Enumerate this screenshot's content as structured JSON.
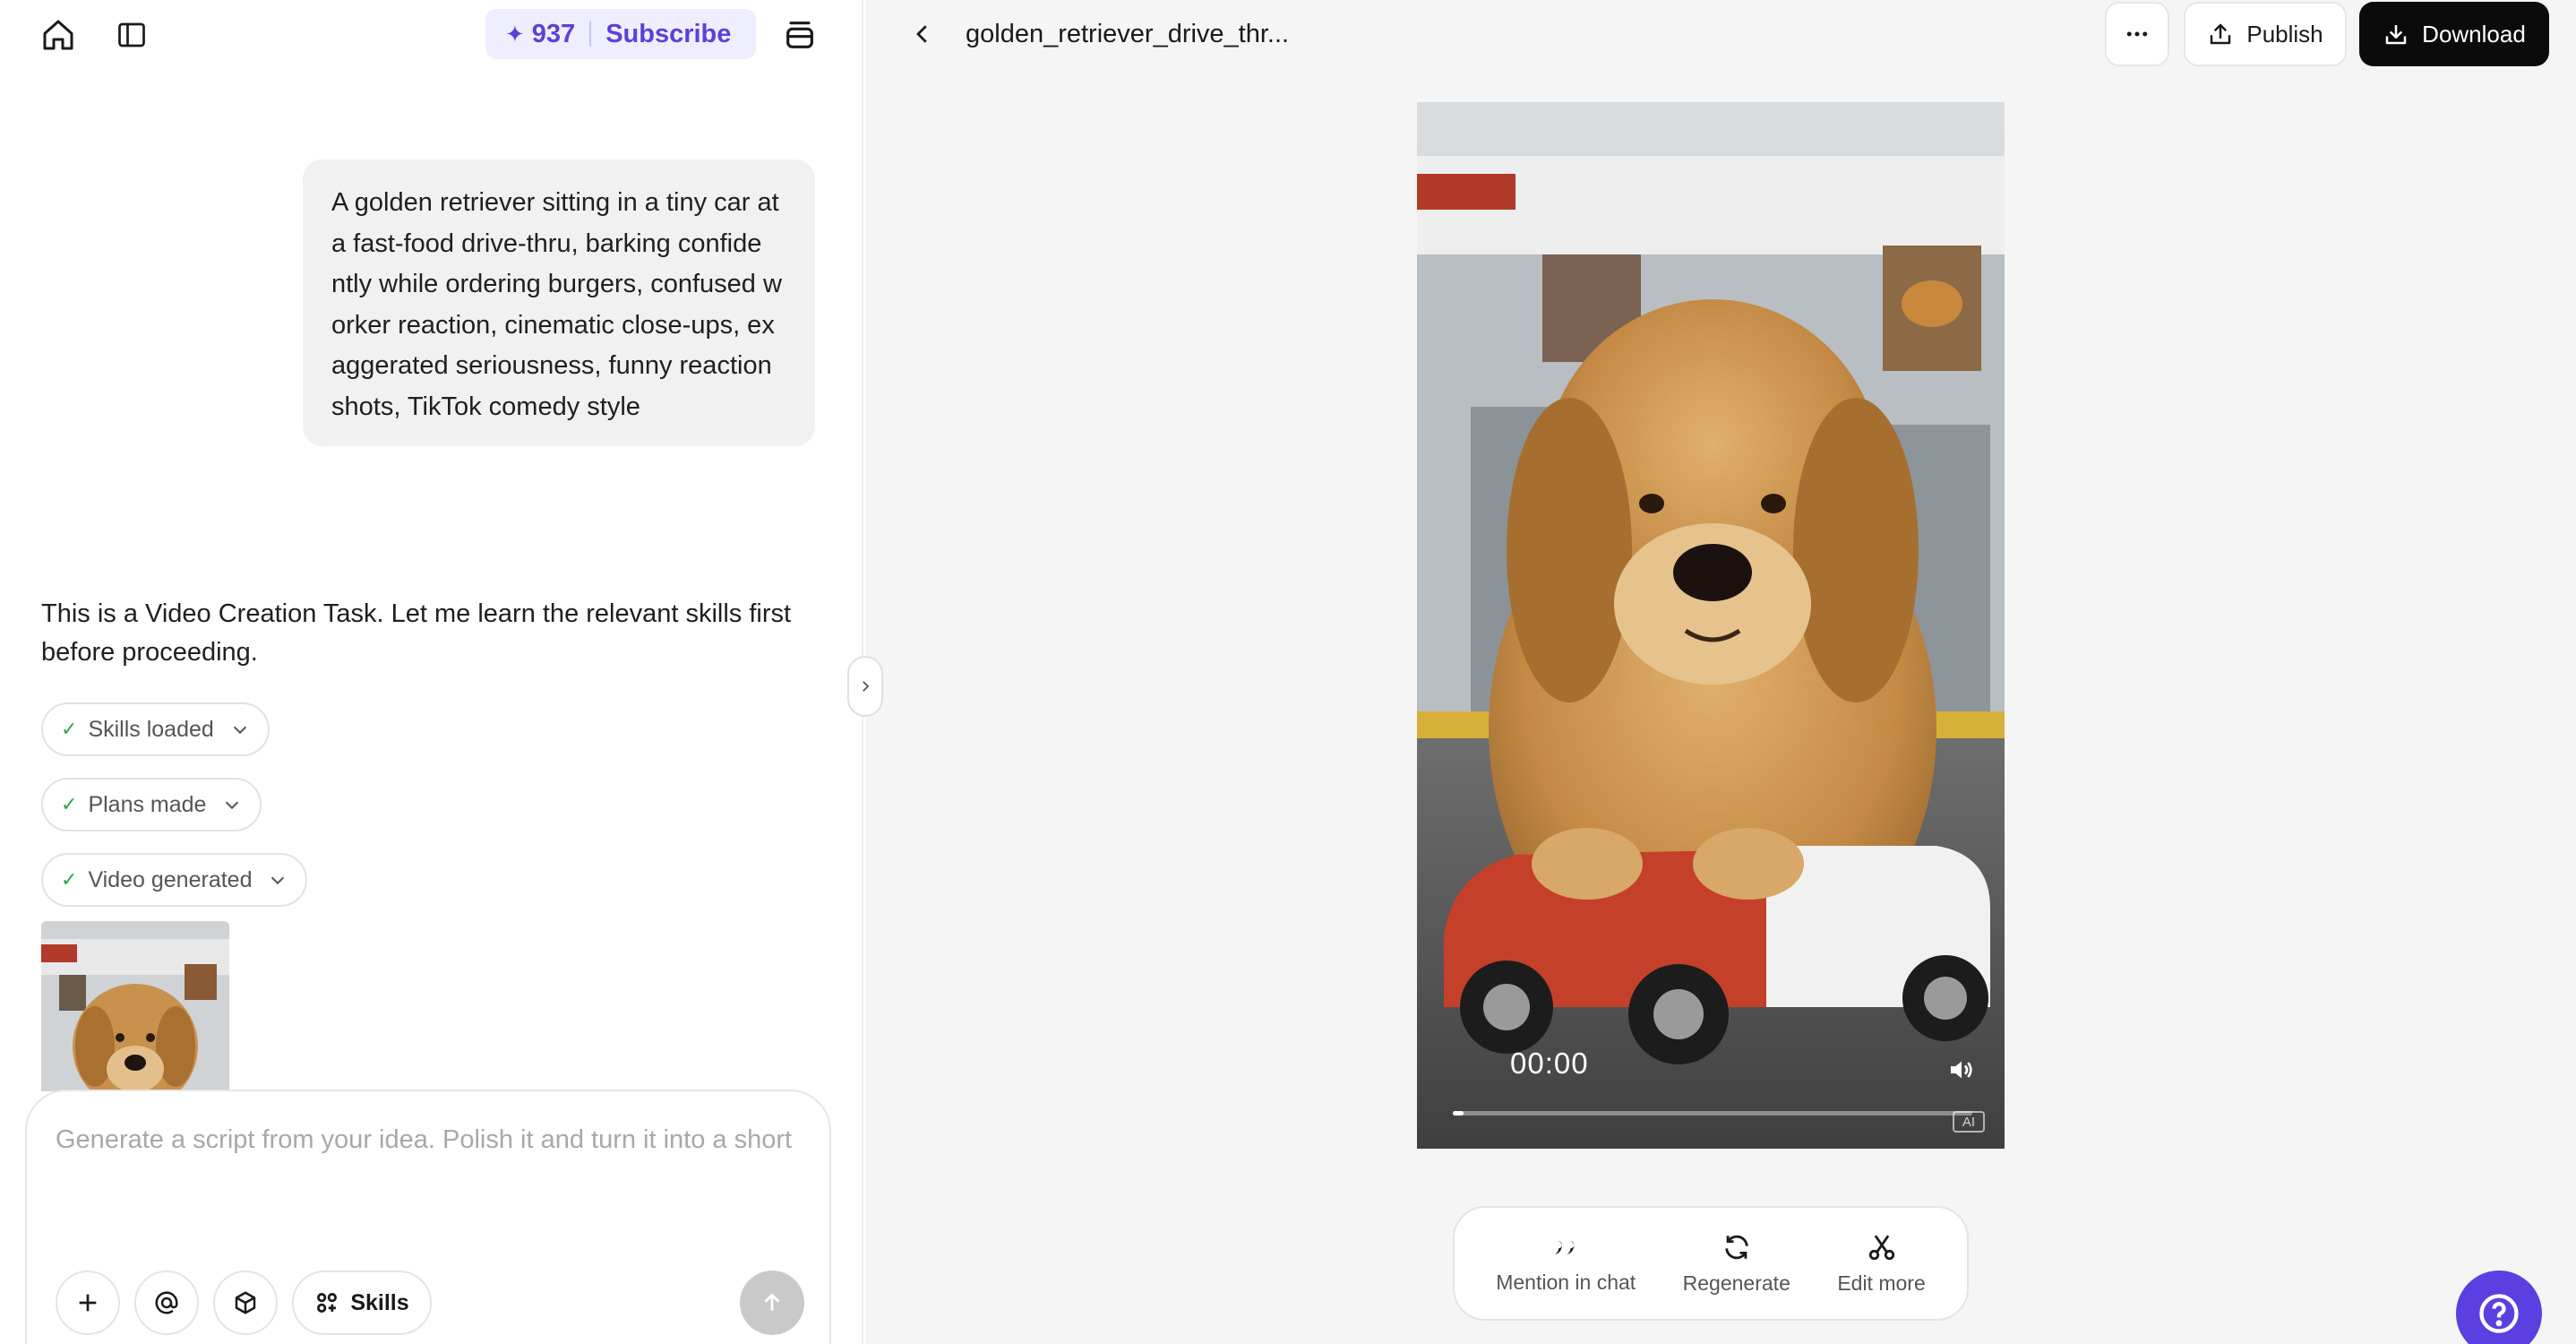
{
  "app": {
    "credits": "937",
    "subscribe_label": "Subscribe"
  },
  "chat": {
    "user_prompt_lines": [
      "A golden retriever sitting in a tiny car at",
      "a fast-food drive-thru, barking confide",
      "ntly while ordering burgers, confused w",
      "orker reaction, cinematic close-ups, ex",
      "aggerated seriousness, funny reaction",
      "shots, TikTok comedy style"
    ],
    "assistant_text_1": "This is a Video Creation Task. Let me learn the relevant skills first",
    "assistant_text_2": "before proceeding.",
    "steps": [
      {
        "label": "Skills loaded"
      },
      {
        "label": "Plans made"
      },
      {
        "label": "Video generated"
      }
    ]
  },
  "composer": {
    "placeholder": "Generate a script from your idea. Polish it and turn it into a short",
    "skills_label": "Skills"
  },
  "viewer": {
    "file_title": "golden_retriever_drive_thr...",
    "publish_label": "Publish",
    "download_label": "Download",
    "timecode": "00:00",
    "progress": 0.02,
    "watermark": "AI"
  },
  "actions": {
    "mention_label": "Mention in chat",
    "regenerate_label": "Regenerate",
    "edit_label": "Edit more"
  },
  "colors": {
    "accent": "#5a42d6",
    "help_button": "#5b3fe0",
    "download_bg": "#0b0b0b",
    "check": "#2fa34f"
  }
}
